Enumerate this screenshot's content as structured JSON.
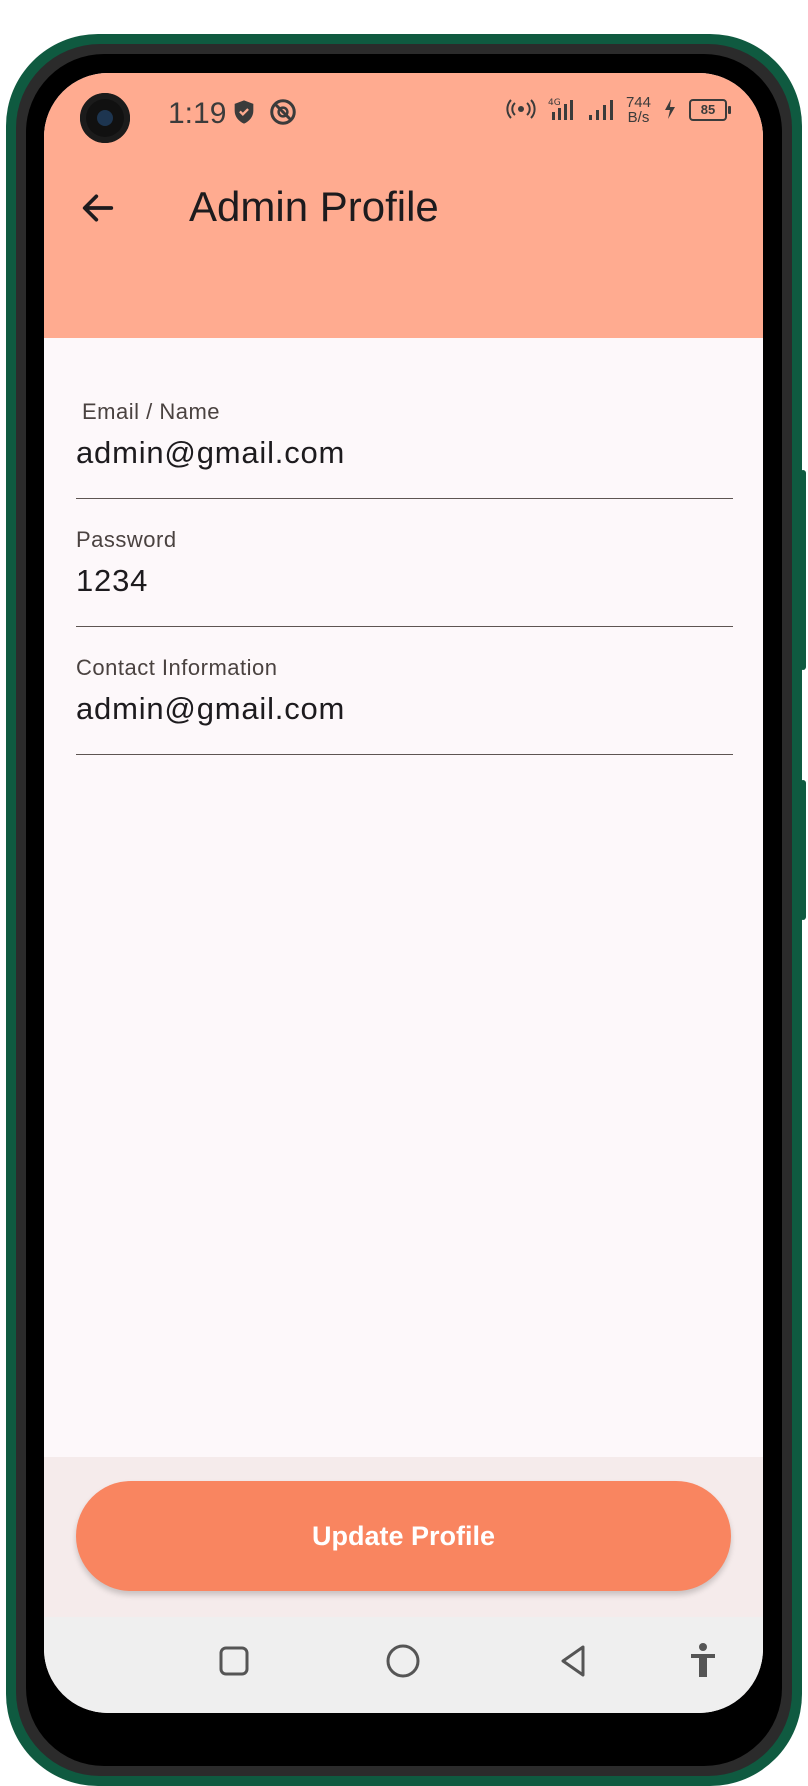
{
  "status_bar": {
    "time": "1:19",
    "net_speed_value": "744",
    "net_speed_unit": "B/s",
    "battery_level": "85",
    "network_type": "4G"
  },
  "app_bar": {
    "title": "Admin Profile"
  },
  "form": {
    "fields": [
      {
        "label": "Email / Name",
        "value": "admin@gmail.com"
      },
      {
        "label": "Password",
        "value": "1234"
      },
      {
        "label": "Contact Information",
        "value": "admin@gmail.com"
      }
    ]
  },
  "actions": {
    "update_label": "Update Profile"
  },
  "colors": {
    "app_bar": "#ffab90",
    "primary_button": "#f98560",
    "screen_background": "#fdf8fa",
    "phone_frame": "#0f5a40"
  }
}
